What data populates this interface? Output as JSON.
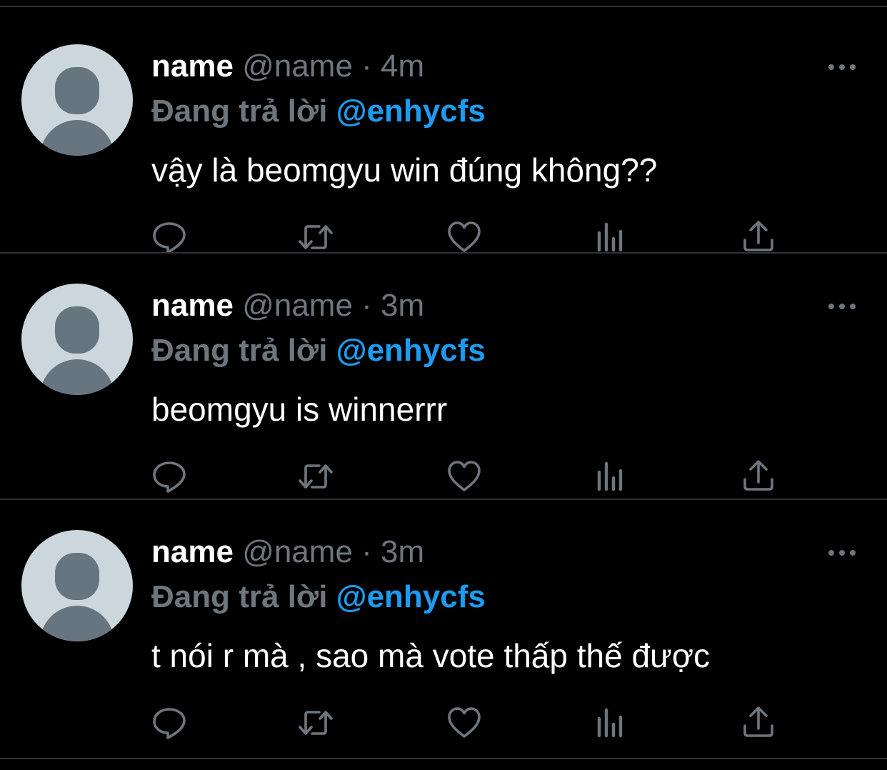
{
  "tweets": [
    {
      "display_name": "name",
      "handle": "@name",
      "separator": "·",
      "time": "4m",
      "reply_label": "Đang trả lời",
      "reply_to": "@enhycfs",
      "text": "vậy là beomgyu win đúng không??"
    },
    {
      "display_name": "name",
      "handle": "@name",
      "separator": "·",
      "time": "3m",
      "reply_label": "Đang trả lời",
      "reply_to": "@enhycfs",
      "text": "beomgyu is winnerrr"
    },
    {
      "display_name": "name",
      "handle": "@name",
      "separator": "·",
      "time": "3m",
      "reply_label": "Đang trả lời",
      "reply_to": "@enhycfs",
      "text": "t nói r mà , sao mà vote thấp thế được"
    }
  ],
  "icons": {
    "more": "more-icon",
    "reply": "reply-icon",
    "retweet": "retweet-icon",
    "like": "heart-icon",
    "analytics": "analytics-icon",
    "share": "share-icon"
  },
  "colors": {
    "background": "#000000",
    "name": "#ffffff",
    "muted": "#6e767d",
    "mention": "#1d9bf0",
    "divider": "#2f3336",
    "avatar_bg": "#ccd6dd",
    "avatar_fg": "#66757f"
  }
}
